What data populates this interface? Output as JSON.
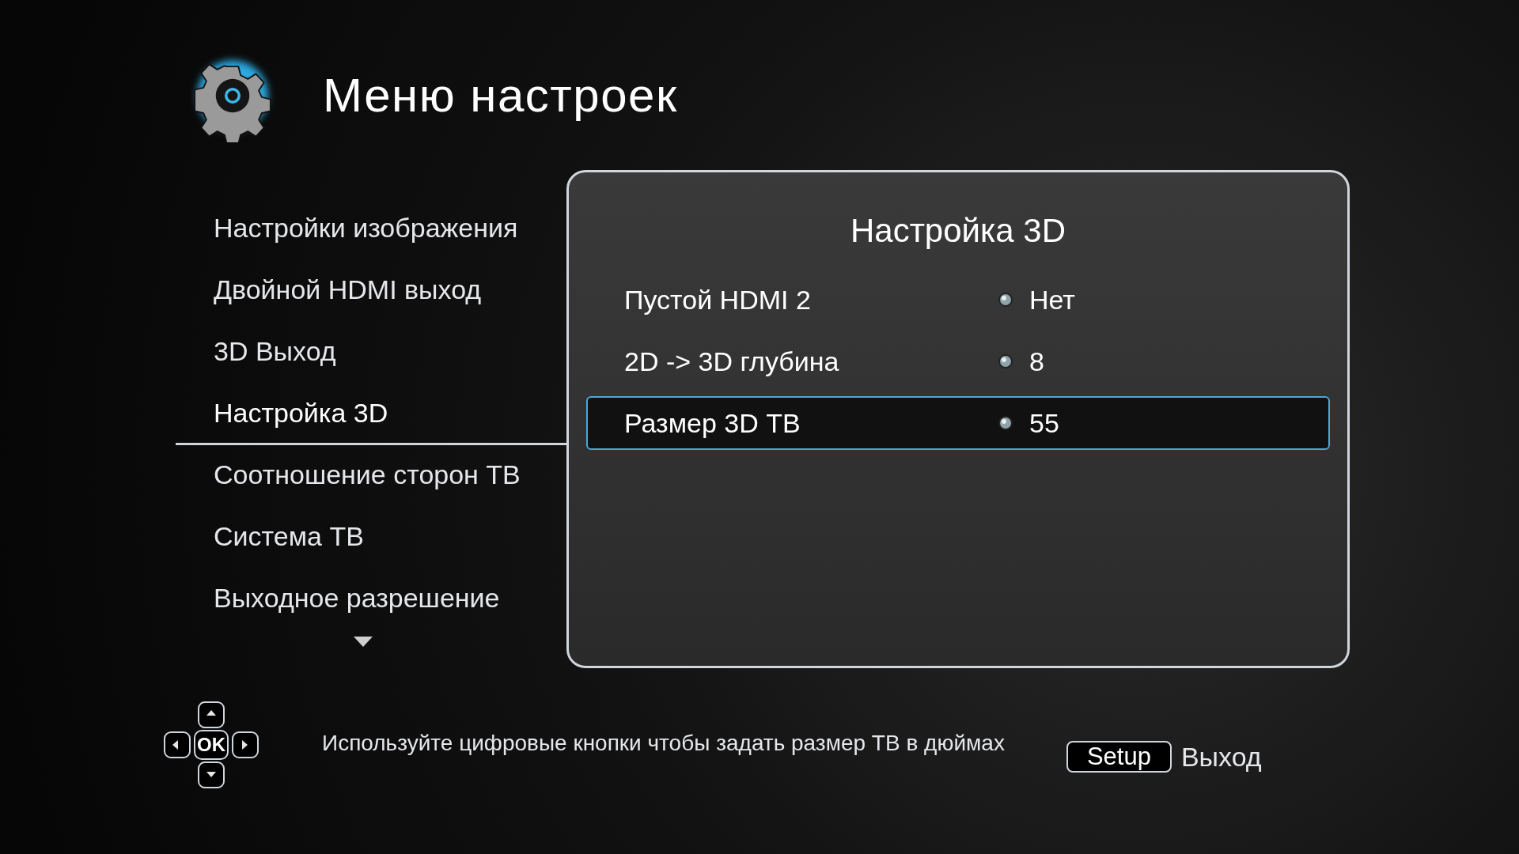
{
  "header": {
    "title": "Меню настроек"
  },
  "menu": {
    "items": [
      {
        "label": "Настройки изображения",
        "selected": false
      },
      {
        "label": "Двойной HDMI выход",
        "selected": false
      },
      {
        "label": "3D Выход",
        "selected": false
      },
      {
        "label": "Настройка 3D",
        "selected": true
      },
      {
        "label": "Соотношение сторон ТВ",
        "selected": false
      },
      {
        "label": "Система ТВ",
        "selected": false
      },
      {
        "label": "Выходное разрешение",
        "selected": false
      }
    ]
  },
  "panel": {
    "title": "Настройка 3D",
    "rows": [
      {
        "label": "Пустой HDMI 2",
        "value": "Нет",
        "selected": false
      },
      {
        "label": "2D -> 3D глубина",
        "value": "8",
        "selected": false
      },
      {
        "label": "Размер 3D ТВ",
        "value": "55",
        "selected": true
      }
    ]
  },
  "footer": {
    "dpad_center": "OK",
    "hint": "Используйте цифровые кнопки чтобы задать размер ТВ в дюймах",
    "key": "Setup",
    "key_label": "Выход"
  }
}
